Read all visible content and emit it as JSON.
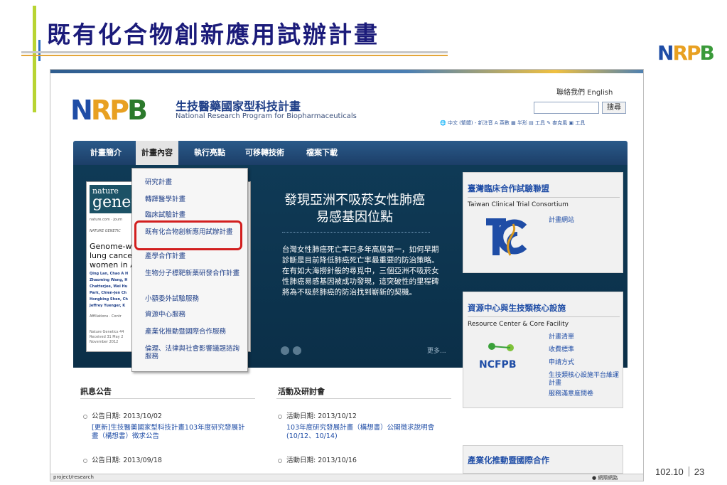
{
  "slide": {
    "title": "既有化合物創新應用試辦計畫",
    "logo_parts": [
      "N",
      "RP",
      "B"
    ],
    "footer_date": "102.10",
    "page_number": "23",
    "accent_colors": {
      "title": "#1b1b7a",
      "bar": "#b8d432",
      "line": "#e4a63a"
    }
  },
  "site": {
    "logo_parts": [
      "N",
      "RP",
      "B"
    ],
    "title": "生技醫藥國家型科技計畫",
    "subtitle": "National Research Program for Biopharmaceuticals",
    "top_links": "聯絡我們  English",
    "search_button": "搜尋",
    "toolbar_text": "🌐 中文 (繁體) - 新注音  A 英數  ▦ 半形  ▤ 工具  ✎ 麥克風  ▣ 工具"
  },
  "nav": {
    "items": [
      "計畫簡介",
      "計畫內容",
      "執行亮點",
      "可移轉技術",
      "檔案下載"
    ],
    "active_index": 1
  },
  "dropdown": {
    "items": [
      "研究計畫",
      "轉譯醫學計畫",
      "臨床試驗計畫",
      "既有化合物創新應用試辦計畫",
      "產學合作計畫",
      "生物分子標靶新藥研發合作計畫",
      "小額委外試驗服務",
      "資源中心服務",
      "產業化推動暨國際合作服務",
      "倫理、法律與社會影響議題諮詢服務"
    ],
    "highlighted_index": 3
  },
  "journal": {
    "masthead_top": "nature",
    "masthead_bottom": "genet",
    "url_line": "nature.com · journ",
    "section_line": "NATURE GENETIC",
    "headline": "Genome-wid\nlung cancer s\nwomen in As",
    "authors": "Qing Lan, Chao A H\nZhaoming Wang, H\nChatterjee, Wei Hu\nPark, Chien-Jen Ch\nHongbing Shen, Ch\nJeffrey Yuenger, K",
    "affiliations": "Affiliations · Contr",
    "refs": "Nature Genetics 44\nReceived 31 May 2\nNovember 2012"
  },
  "banner": {
    "heading": "發現亞洲不吸菸女性肺癌\n易感基因位點",
    "body": "台灣女性肺癌死亡率已多年高居第一，如何早期診斷是目前降低肺癌死亡率最重要的防治策略。在有如大海撈針般的尋覓中，三個亞洲不吸菸女性肺癌易感基因被成功發現，這突破性的里程碑將為不吸菸肺癌的防治找到嶄新的契機。",
    "more": "更多..."
  },
  "panels": {
    "tcc": {
      "title": "臺灣臨床合作試驗聯盟",
      "subtitle": "Taiwan Clinical Trial Consortium",
      "links": [
        "計畫網站"
      ]
    },
    "core": {
      "title": "資源中心與生技類核心設施",
      "subtitle": "Resource Center & Core Facility",
      "logo_text": "NCFPB",
      "links": [
        "計畫清單",
        "收費標準",
        "申請方式",
        "生技類核心設施平台維運計畫",
        "服務滿意度問卷"
      ]
    },
    "industry": {
      "title": "產業化推動暨國際合作"
    }
  },
  "news": {
    "title": "訊息公告",
    "items": [
      {
        "date": "公告日期: 2013/10/02",
        "text": "[更新]生技醫藥國家型科技計畫103年度研究發展計\n畫（構想書）徵求公告"
      },
      {
        "date": "公告日期: 2013/09/18",
        "text": ""
      }
    ]
  },
  "events": {
    "title": "活動及研討會",
    "items": [
      {
        "date": "活動日期: 2013/10/12",
        "text": "103年度研究發展計畫（構想書）公開徵求說明會\n(10/12、10/14)"
      },
      {
        "date": "活動日期: 2013/10/16",
        "text": ""
      }
    ]
  },
  "statusbar": {
    "url": "project/research",
    "zone": "網際網路"
  }
}
